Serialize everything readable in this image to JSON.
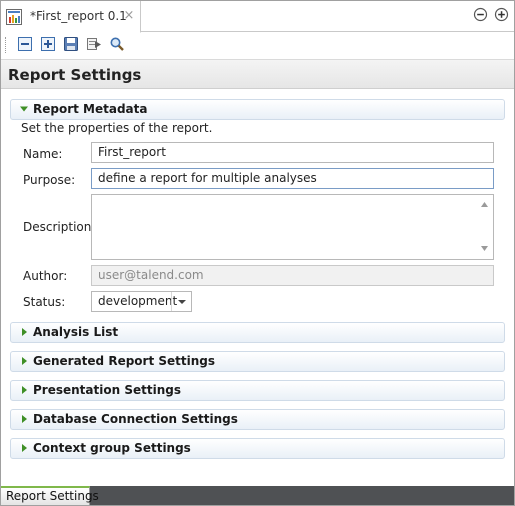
{
  "editor": {
    "tab_label": "*First_report 0.1",
    "tab_close": "×"
  },
  "header": {
    "title": "Report Settings"
  },
  "metadata_section": {
    "title": "Report Metadata",
    "description": "Set the properties of the report.",
    "fields": {
      "name_label": "Name:",
      "name_value": "First_report",
      "purpose_label": "Purpose:",
      "purpose_value": "define a report for multiple analyses",
      "description_label": "Description:",
      "description_value": "",
      "author_label": "Author:",
      "author_value": "user@talend.com",
      "status_label": "Status:",
      "status_value": "development"
    }
  },
  "collapsed_sections": [
    {
      "title": "Analysis List"
    },
    {
      "title": "Generated Report Settings"
    },
    {
      "title": "Presentation Settings"
    },
    {
      "title": "Database Connection Settings"
    },
    {
      "title": "Context group Settings"
    }
  ],
  "bottom_tabs": {
    "active_label": "Report Settings"
  },
  "icons": {
    "tab_icon": "report-chart-icon",
    "toolbar": [
      "collapse-all-icon",
      "expand-all-icon",
      "save-icon",
      "run-report-icon",
      "search-icon"
    ],
    "window": [
      "minimize-icon",
      "maximize-icon"
    ]
  },
  "colors": {
    "section_twisty": "#3f8f26",
    "active_tab_accent": "#7fb84a",
    "bottom_bar": "#4f5154"
  }
}
